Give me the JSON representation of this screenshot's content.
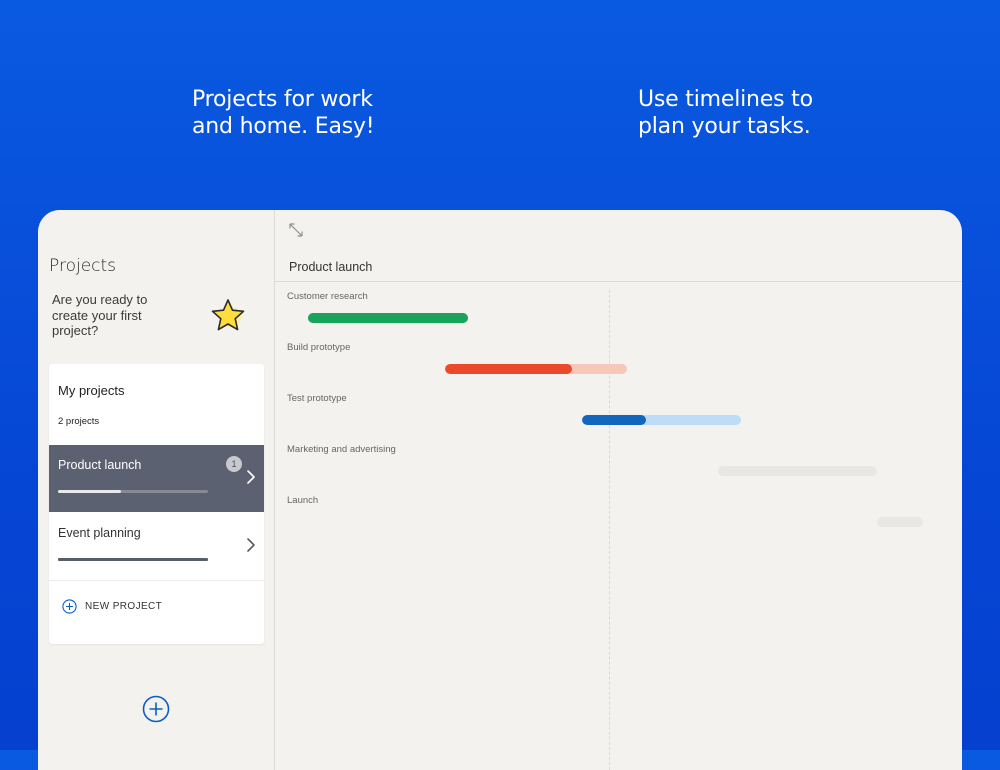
{
  "marketing": {
    "left_headline": "Projects for work\nand home. Easy!",
    "right_headline": "Use timelines to\nplan your tasks."
  },
  "sidebar": {
    "title": "Projects",
    "prompt": "Are you ready to\ncreate your first\nproject?",
    "card": {
      "title": "My projects",
      "count": "2 projects",
      "projects": [
        {
          "name": "Product launch",
          "badge": "1",
          "progress": 0.42,
          "selected": true
        },
        {
          "name": "Event planning",
          "progress": 1.0,
          "selected": false
        }
      ],
      "new_project_label": "NEW PROJECT"
    }
  },
  "timeline": {
    "title": "Product launch",
    "tasks": [
      {
        "name": "Customer research",
        "track_color": "#1aa35a",
        "done_color": "#1aa35a",
        "done": 1.0
      },
      {
        "name": "Build prototype",
        "track_color": "#f7c7b8",
        "done_color": "#ea4a2b",
        "done": 0.7
      },
      {
        "name": "Test prototype",
        "track_color": "#bcdcf8",
        "done_color": "#1366bd",
        "done": 0.4
      },
      {
        "name": "Marketing and advertising",
        "track_color": "#e9e7e4",
        "done_color": "#e9e7e4",
        "done": 0
      },
      {
        "name": "Launch",
        "track_color": "#e9e7e4",
        "done_color": "#e9e7e4",
        "done": 0
      }
    ]
  },
  "colors": {
    "background": "#0a5ae0",
    "accent": "#0c5cc4",
    "selected_row": "#5b6170"
  },
  "icons": {
    "star": "star-icon",
    "chevron": "chevron-right-icon",
    "expand": "expand-icon",
    "add": "plus-circle-icon"
  }
}
